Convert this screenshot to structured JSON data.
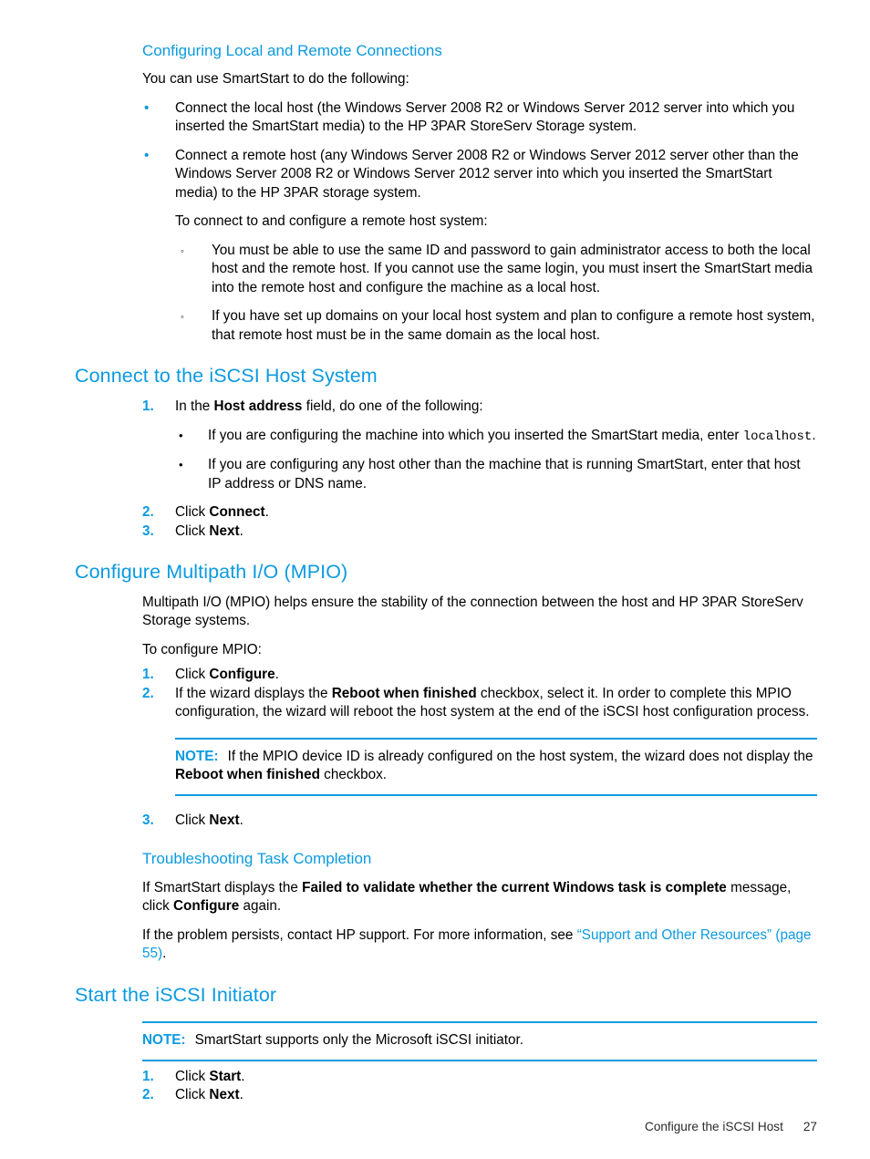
{
  "sections": {
    "configuring_connections": {
      "heading": "Configuring Local and Remote Connections",
      "intro": "You can use SmartStart to do the following:",
      "bullets": [
        "Connect the local host (the Windows Server 2008 R2 or Windows Server 2012 server into which you inserted the SmartStart media) to the HP 3PAR StoreServ Storage system.",
        "Connect a remote host (any Windows Server 2008 R2 or Windows Server 2012 server other than the Windows Server 2008 R2 or Windows Server 2012 server into which you inserted the SmartStart media) to the HP 3PAR storage system."
      ],
      "subintro": "To connect to and configure a remote host system:",
      "subbullets": [
        "You must be able to use the same ID and password to gain administrator access to both the local host and the remote host. If you cannot use the same login, you must insert the SmartStart media into the remote host and configure the machine as a local host.",
        "If you have set up domains on your local host system and plan to configure a remote host system, that remote host must be in the same domain as the local host."
      ]
    },
    "connect_iscsi_host": {
      "heading": "Connect to the iSCSI Host System",
      "step1": {
        "marker": "1.",
        "pre": "In the ",
        "bold": "Host address",
        "post": " field, do one of the following:"
      },
      "nested": [
        {
          "pre": "If you are configuring the machine into which you inserted the SmartStart media, enter ",
          "mono": "localhost",
          "post": "."
        },
        {
          "pre": "If you are configuring any host other than the machine that is running SmartStart, enter that host IP address or DNS name.",
          "mono": "",
          "post": ""
        }
      ],
      "step2": {
        "marker": "2.",
        "pre": "Click ",
        "bold": "Connect",
        "post": "."
      },
      "step3": {
        "marker": "3.",
        "pre": "Click ",
        "bold": "Next",
        "post": "."
      }
    },
    "configure_mpio": {
      "heading": "Configure Multipath I/O (MPIO)",
      "intro": "Multipath I/O (MPIO) helps ensure the stability of the connection between the host and HP 3PAR StoreServ Storage systems.",
      "subintro": "To configure MPIO:",
      "step1": {
        "marker": "1.",
        "pre": "Click ",
        "bold": "Configure",
        "post": "."
      },
      "step2": {
        "marker": "2.",
        "pre": "If the wizard displays the ",
        "bold": "Reboot when finished",
        "post": " checkbox, select it. In order to complete this MPIO configuration, the wizard will reboot the host system at the end of the iSCSI host configuration process."
      },
      "note": {
        "label": "NOTE:",
        "pre": "If the MPIO device ID is already configured on the host system, the wizard does not display the ",
        "bold": "Reboot when finished",
        "post": " checkbox."
      },
      "step3": {
        "marker": "3.",
        "pre": "Click ",
        "bold": "Next",
        "post": "."
      }
    },
    "troubleshooting": {
      "heading": "Troubleshooting Task Completion",
      "para1": {
        "pre": "If SmartStart displays the ",
        "bold1": "Failed to validate whether the current Windows task is complete",
        "mid": " message, click ",
        "bold2": "Configure",
        "post": " again."
      },
      "para2": {
        "pre": "If the problem persists, contact HP support. For more information, see ",
        "link": "“Support and Other Resources”",
        "link2": "(page 55)",
        "post": "."
      }
    },
    "start_iscsi_initiator": {
      "heading": "Start the iSCSI Initiator",
      "note": {
        "label": "NOTE:",
        "text": "SmartStart supports only the Microsoft iSCSI initiator."
      },
      "step1": {
        "marker": "1.",
        "pre": "Click ",
        "bold": "Start",
        "post": "."
      },
      "step2": {
        "marker": "2.",
        "pre": "Click ",
        "bold": "Next",
        "post": "."
      }
    }
  },
  "markers": {
    "blue_dot": "•",
    "black_dot": "•",
    "hollow_circle": "◦"
  },
  "footer": {
    "chapter": "Configure the iSCSI Host",
    "page_number": "27"
  },
  "colors": {
    "heading_blue": "#0b9ae0",
    "link_blue": "#0b9ae0",
    "text_black": "#000000"
  }
}
